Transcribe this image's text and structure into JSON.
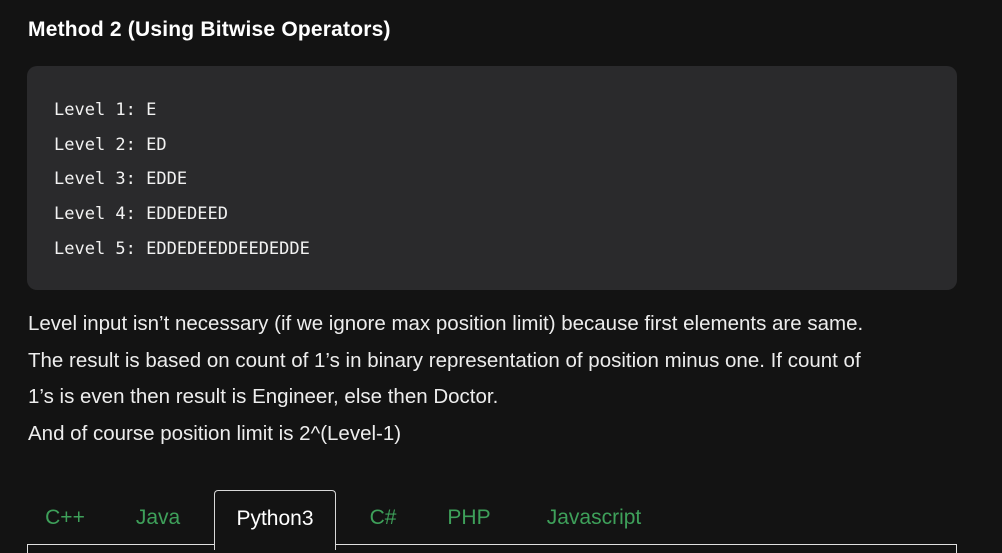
{
  "section": {
    "title": "Method 2 (Using Bitwise Operators)"
  },
  "code_block": {
    "lines": [
      "Level 1: E",
      "Level 2: ED",
      "Level 3: EDDE",
      "Level 4: EDDEDEED",
      "Level 5: EDDEDEEDDEEDEDDE"
    ]
  },
  "description": {
    "paragraph_1": "Level input isn’t necessary (if we ignore max position limit) because first elements are same.",
    "paragraph_2": "The result is based on count of 1’s in binary representation of position minus one. If count of",
    "paragraph_3": "1’s is even then result is Engineer, else then Doctor.",
    "paragraph_4": "And of course position limit is 2^(Level-1)"
  },
  "tabs": {
    "items": [
      {
        "label": "C++",
        "active": false
      },
      {
        "label": "Java",
        "active": false
      },
      {
        "label": "Python3",
        "active": true
      },
      {
        "label": "C#",
        "active": false
      },
      {
        "label": "PHP",
        "active": false
      },
      {
        "label": "Javascript",
        "active": false
      }
    ]
  },
  "colors": {
    "background": "#131313",
    "code_background": "#2a2a2c",
    "tab_inactive": "#3ea05a",
    "tab_active": "#ffffff"
  }
}
